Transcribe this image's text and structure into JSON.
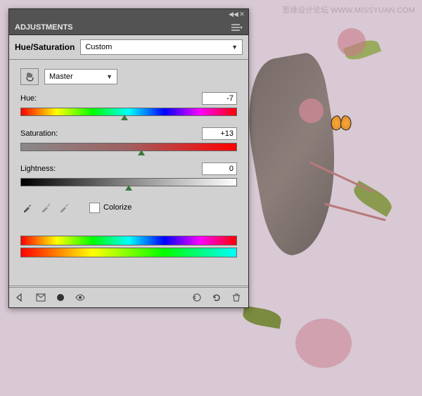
{
  "watermark": "思缘设计论坛 WWW.MISSYUAN.COM",
  "panel": {
    "title": "ADJUSTMENTS",
    "adjustment_type": "Hue/Saturation",
    "preset": "Custom",
    "range": "Master",
    "hue": {
      "label": "Hue:",
      "value": "-7",
      "pos": 48
    },
    "saturation": {
      "label": "Saturation:",
      "value": "+13",
      "pos": 56
    },
    "lightness": {
      "label": "Lightness:",
      "value": "0",
      "pos": 50
    },
    "colorize": {
      "label": "Colorize",
      "checked": false
    }
  }
}
